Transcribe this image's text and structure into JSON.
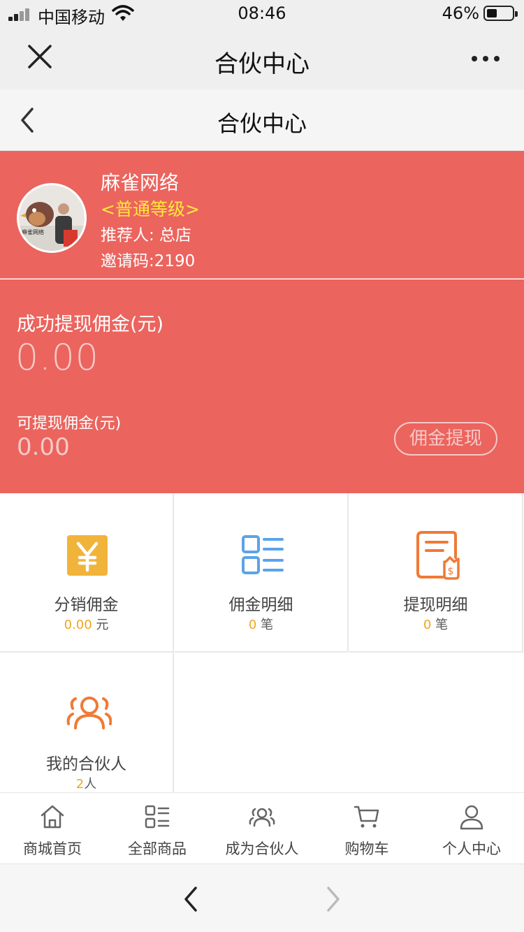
{
  "status_bar": {
    "carrier": "中国移动",
    "time": "08:46",
    "battery": "46%"
  },
  "wechat_bar": {
    "title": "合伙中心"
  },
  "header": {
    "title": "合伙中心"
  },
  "profile": {
    "name": "麻雀网络",
    "level": "<普通等级>",
    "referrer": "推荐人: 总店",
    "invite_code": "邀请码:2190",
    "avatar_logo_text": "麻雀网络"
  },
  "commission": {
    "success_label": "成功提现佣金(元)",
    "success_amount": "0.00",
    "available_label": "可提现佣金(元)",
    "available_amount": "0.00",
    "withdraw_button": "佣金提现"
  },
  "grid": [
    {
      "label": "分销佣金",
      "value": "0.00",
      "unit": "元",
      "icon": "yen-icon"
    },
    {
      "label": "佣金明细",
      "value": "0",
      "unit": "笔",
      "icon": "list-icon"
    },
    {
      "label": "提现明细",
      "value": "0",
      "unit": "笔",
      "icon": "withdraw-document-icon"
    },
    {
      "label": "我的合伙人",
      "value": "2",
      "unit": "人",
      "icon": "people-icon"
    }
  ],
  "tabs": [
    {
      "label": "商城首页",
      "icon": "home-icon"
    },
    {
      "label": "全部商品",
      "icon": "grid-list-icon"
    },
    {
      "label": "成为合伙人",
      "icon": "partners-icon"
    },
    {
      "label": "购物车",
      "icon": "cart-icon"
    },
    {
      "label": "个人中心",
      "icon": "user-icon"
    }
  ],
  "colors": {
    "banner": "#eb645e",
    "accent_yellow": "#f0a623",
    "icon_blue": "#5ba4e8",
    "icon_orange": "#f07a36",
    "level_yellow": "#ffe83a"
  }
}
